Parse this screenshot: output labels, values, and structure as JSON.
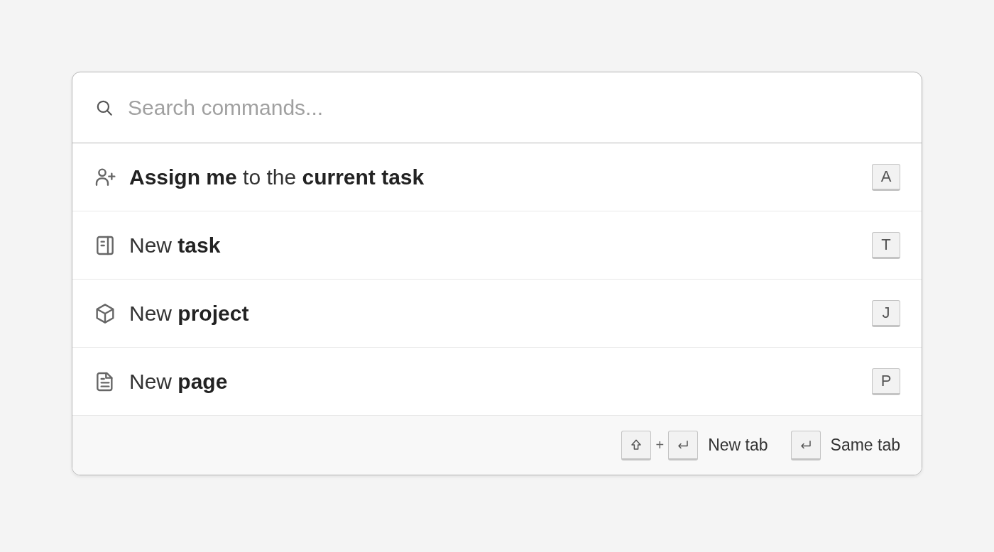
{
  "search": {
    "placeholder": "Search commands..."
  },
  "commands": [
    {
      "kind": "person-add",
      "label": "**Assign me** to the **current task**",
      "key": "A"
    },
    {
      "kind": "task",
      "label": "New **task**",
      "key": "T"
    },
    {
      "kind": "project",
      "label": "New **project**",
      "key": "J"
    },
    {
      "kind": "page",
      "label": "New **page**",
      "key": "P"
    }
  ],
  "footer": {
    "hints": [
      {
        "keys": [
          {
            "kind": "shift"
          },
          {
            "kind": "plus",
            "text": "+"
          },
          {
            "kind": "enter"
          }
        ],
        "label": "New tab"
      },
      {
        "keys": [
          {
            "kind": "enter"
          }
        ],
        "label": "Same tab"
      }
    ]
  }
}
